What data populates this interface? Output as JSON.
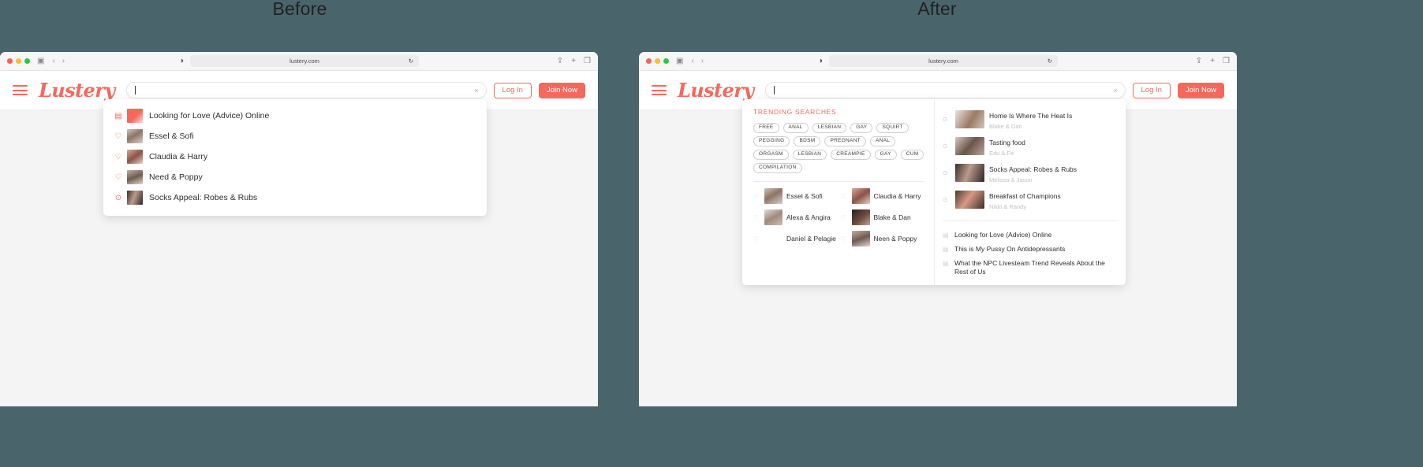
{
  "labels": {
    "before": "Before",
    "after": "After"
  },
  "browser": {
    "url": "lustery.com",
    "icons": {
      "sidebar": "sidebar-icon",
      "back": "back-arrow-icon",
      "forward": "forward-arrow-icon",
      "shield": "privacy-shield-icon",
      "reload": "reload-icon",
      "share": "share-icon",
      "newtab": "new-tab-icon",
      "tabs": "tab-overview-icon"
    }
  },
  "header": {
    "logo": "Lustery",
    "search_value": "",
    "search_placeholder": "",
    "login_label": "Log In",
    "join_label": "Join Now"
  },
  "colors": {
    "accent": "#f4695c",
    "desktop": "#49656b"
  },
  "before": {
    "results": [
      {
        "label": "Looking for Love (Advice) Online",
        "icon": "article-icon",
        "thumb": "thumb-article-red"
      },
      {
        "label": "Essel & Sofi",
        "icon": "couple-heart-icon",
        "thumb": "thumb-couple-1"
      },
      {
        "label": "Claudia & Harry",
        "icon": "couple-heart-icon",
        "thumb": "thumb-couple-2"
      },
      {
        "label": "Need & Poppy",
        "icon": "couple-heart-icon",
        "thumb": "thumb-couple-3"
      },
      {
        "label": "Socks Appeal: Robes & Rubs",
        "icon": "video-play-icon",
        "thumb": "thumb-video-1"
      }
    ]
  },
  "after": {
    "trending_title": "TRENDING SEARCHES",
    "tags": [
      "FREE",
      "ANAL",
      "LESBIAN",
      "GAY",
      "SQUIRT",
      "PEGGING",
      "BDSM",
      "PREGNANT",
      "ANAL",
      "ORGASM",
      "LESBIAN",
      "CREAMPIE",
      "GAY",
      "CUM",
      "COMPILATION"
    ],
    "couples": [
      {
        "name": "Essel & Sofi",
        "thumb": "thumb-couple-1"
      },
      {
        "name": "Claudia & Harry",
        "thumb": "thumb-couple-2"
      },
      {
        "name": "Alexa & Angira",
        "thumb": "thumb-couple-4"
      },
      {
        "name": "Blake & Dan",
        "thumb": "thumb-couple-5"
      },
      {
        "name": "Daniel & Pelagie",
        "thumb": "thumb-couple-6"
      },
      {
        "name": "Neen & Poppy",
        "thumb": "thumb-couple-3"
      }
    ],
    "videos": [
      {
        "title": "Home Is Where The Heat Is",
        "sub": "Blake & Dan",
        "thumb": "thumb-video-2"
      },
      {
        "title": "Tasting food",
        "sub": "Edu & Fe",
        "thumb": "thumb-video-3"
      },
      {
        "title": "Socks Appeal: Robes & Rubs",
        "sub": "Melissa & Jason",
        "thumb": "thumb-video-1"
      },
      {
        "title": "Breakfast of Champions",
        "sub": "Nikki & Randy",
        "thumb": "thumb-video-4"
      }
    ],
    "articles": [
      "Looking for Love (Advice) Online",
      "This is My Pussy On Antidepressants",
      "What the NPC Livesteam Trend Reveals About the Rest of Us"
    ]
  }
}
